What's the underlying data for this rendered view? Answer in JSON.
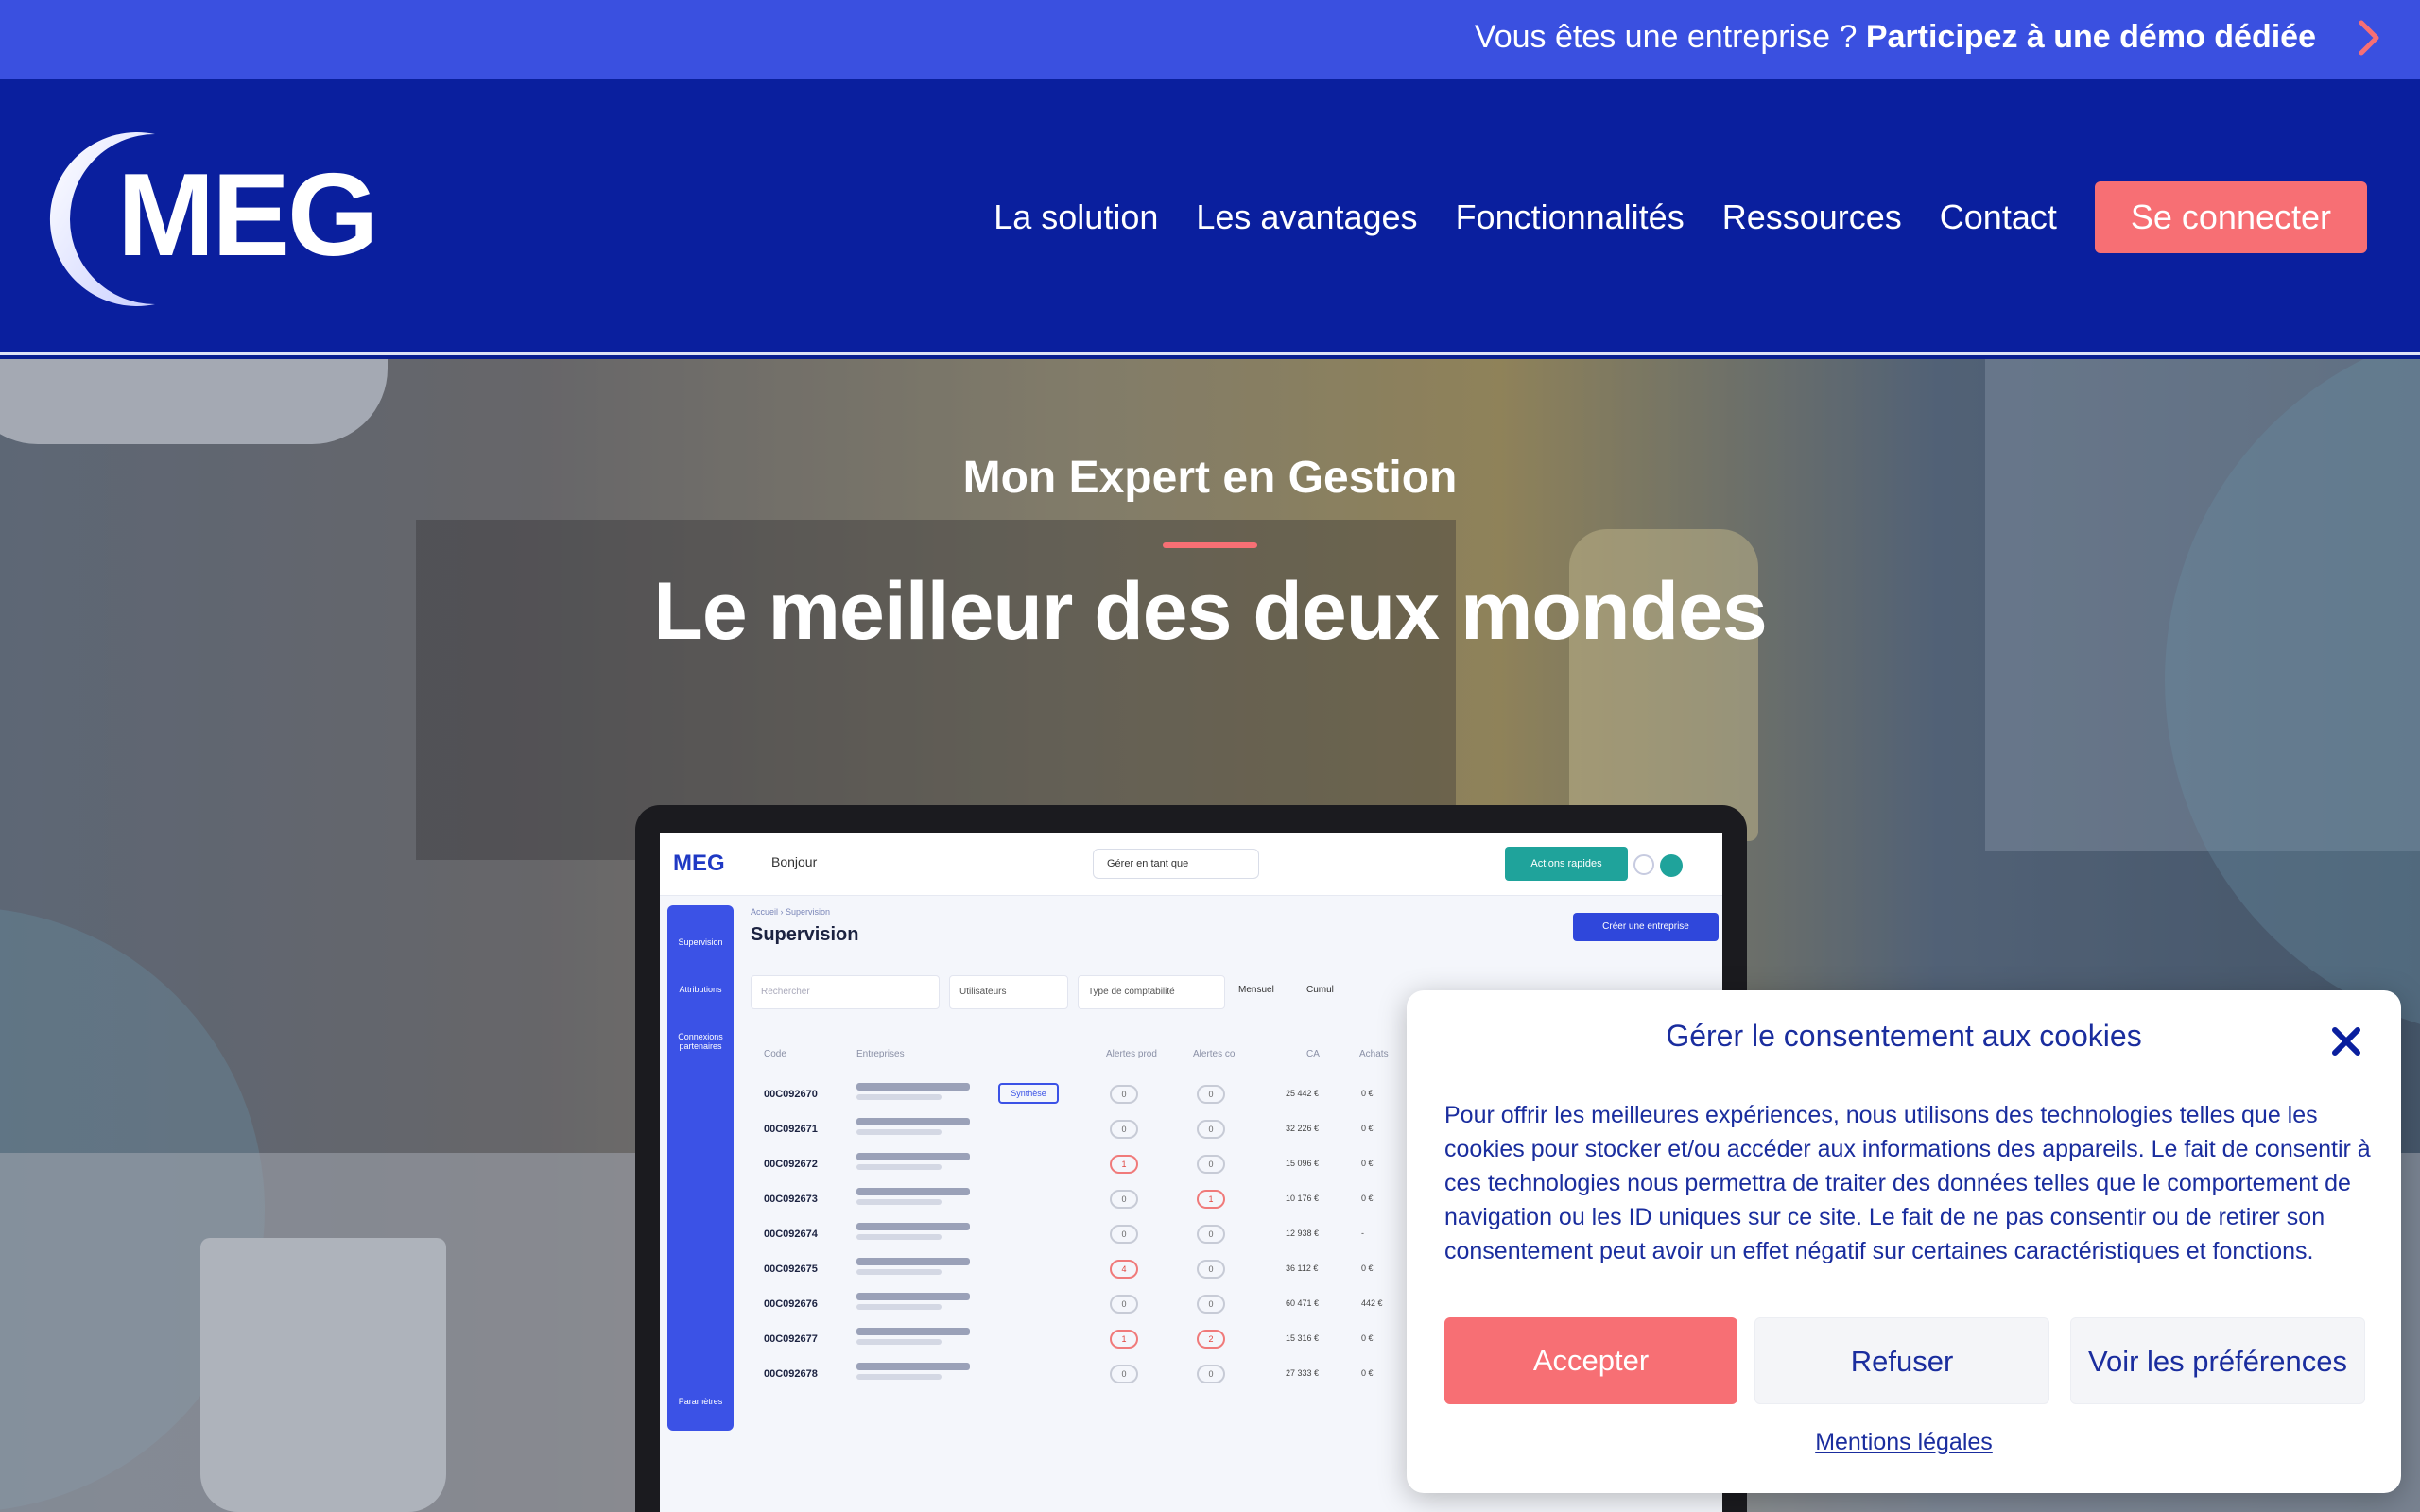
{
  "topbar": {
    "lead": "Vous êtes une entreprise ? ",
    "cta": "Participez à une démo dédiée",
    "chevron_icon": "chevron-right-icon",
    "chevron_color": "#f76f74"
  },
  "header": {
    "logo_text": "MEG",
    "nav": [
      "La solution",
      "Les avantages",
      "Fonctionnalités",
      "Ressources",
      "Contact"
    ],
    "login_label": "Se connecter",
    "accent_color": "#f76f74",
    "background_color": "#0a1f9e"
  },
  "hero": {
    "subtitle": "Mon Expert en Gestion",
    "title": "Le meilleur des deux mondes"
  },
  "app_mock": {
    "logo": "MEG",
    "greeting": "Bonjour",
    "select_label": "Gérer en tant que",
    "actions_label": "Actions rapides",
    "breadcrumb": "Accueil › Supervision",
    "page_title": "Supervision",
    "create_label": "Créer une entreprise",
    "sidebar": [
      "Supervision",
      "Attributions",
      "Connexions partenaires",
      "Paramètres"
    ],
    "filters": {
      "search_placeholder": "Rechercher",
      "users": "Utilisateurs",
      "accounting": "Type de comptabilité",
      "monthly": "Mensuel",
      "cumulative": "Cumul"
    },
    "columns": [
      "Code",
      "Entreprises",
      "Alertes prod",
      "Alertes co",
      "CA",
      "Achats"
    ],
    "synthese_label": "Synthèse",
    "rows": [
      {
        "code": "00C092670",
        "a1": "0",
        "a2": "0",
        "ca": "25 442 €",
        "achats": "0 €",
        "red1": false,
        "red2": false
      },
      {
        "code": "00C092671",
        "a1": "0",
        "a2": "0",
        "ca": "32 226 €",
        "achats": "0 €",
        "red1": false,
        "red2": false
      },
      {
        "code": "00C092672",
        "a1": "1",
        "a2": "0",
        "ca": "15 096 €",
        "achats": "0 €",
        "red1": true,
        "red2": false
      },
      {
        "code": "00C092673",
        "a1": "0",
        "a2": "1",
        "ca": "10 176 €",
        "achats": "0 €",
        "red1": false,
        "red2": true
      },
      {
        "code": "00C092674",
        "a1": "0",
        "a2": "0",
        "ca": "12 938 €",
        "achats": "-",
        "red1": false,
        "red2": false
      },
      {
        "code": "00C092675",
        "a1": "4",
        "a2": "0",
        "ca": "36 112 €",
        "achats": "0 €",
        "red1": true,
        "red2": false
      },
      {
        "code": "00C092676",
        "a1": "0",
        "a2": "0",
        "ca": "60 471 €",
        "achats": "442 €",
        "red1": false,
        "red2": false
      },
      {
        "code": "00C092677",
        "a1": "1",
        "a2": "2",
        "ca": "15 316 €",
        "achats": "0 €",
        "red1": true,
        "red2": true
      },
      {
        "code": "00C092678",
        "a1": "0",
        "a2": "0",
        "ca": "27 333 €",
        "achats": "0 €",
        "red1": false,
        "red2": false
      }
    ]
  },
  "cookie": {
    "title": "Gérer le consentement aux cookies",
    "close_icon": "close-icon",
    "body": "Pour offrir les meilleures expériences, nous utilisons des technologies telles que les cookies pour stocker et/ou accéder aux informations des appareils. Le fait de consentir à ces technologies nous permettra de traiter des données telles que le comportement de navigation ou les ID uniques sur ce site. Le fait de ne pas consentir ou de retirer son consentement peut avoir un effet négatif sur certaines caractéristiques et fonctions.",
    "accept": "Accepter",
    "refuse": "Refuser",
    "preferences": "Voir les préférences",
    "legal_link": "Mentions légales"
  }
}
